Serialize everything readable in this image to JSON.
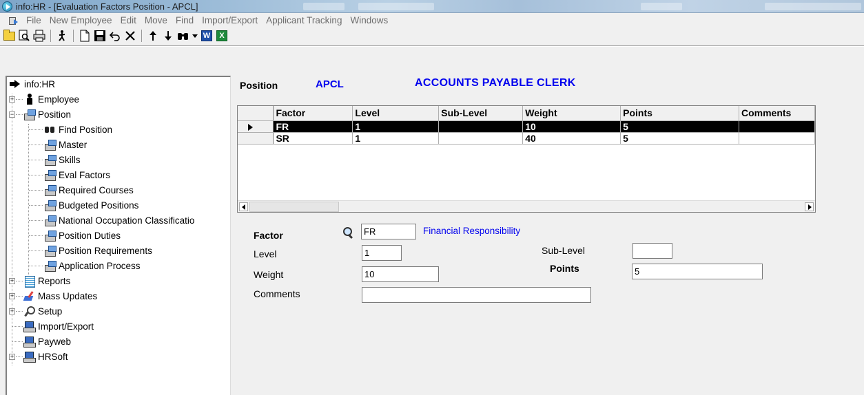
{
  "window": {
    "title": "info:HR - [Evaluation Factors Position - APCL]"
  },
  "menu": [
    "File",
    "New Employee",
    "Edit",
    "Move",
    "Find",
    "Import/Export",
    "Applicant Tracking",
    "Windows"
  ],
  "toolbar": {
    "icons": [
      "open-folder-icon",
      "print-preview-icon",
      "print-icon",
      "run-icon",
      "new-icon",
      "save-icon",
      "undo-icon",
      "delete-icon",
      "move-up-icon",
      "move-down-icon",
      "find-icon",
      "dropdown-icon",
      "word-icon",
      "excel-icon"
    ],
    "word_label": "W",
    "excel_label": "X"
  },
  "tree": {
    "root": "info:HR",
    "items": [
      {
        "label": "Employee"
      },
      {
        "label": "Position"
      },
      {
        "label": "Find Position"
      },
      {
        "label": "Master"
      },
      {
        "label": "Skills"
      },
      {
        "label": "Eval Factors"
      },
      {
        "label": "Required Courses"
      },
      {
        "label": "Budgeted Positions"
      },
      {
        "label": "National Occupation Classificatio"
      },
      {
        "label": "Position Duties"
      },
      {
        "label": "Position Requirements"
      },
      {
        "label": "Application Process"
      },
      {
        "label": "Reports"
      },
      {
        "label": "Mass Updates"
      },
      {
        "label": "Setup"
      },
      {
        "label": "Import/Export"
      },
      {
        "label": "Payweb"
      },
      {
        "label": "HRSoft"
      }
    ]
  },
  "position": {
    "label": "Position",
    "code": "APCL",
    "description": "ACCOUNTS PAYABLE CLERK"
  },
  "grid": {
    "columns": [
      "Factor",
      "Level",
      "Sub-Level",
      "Weight",
      "Points",
      "Comments"
    ],
    "rows": [
      [
        "FR",
        "1",
        "",
        "10",
        "5",
        ""
      ],
      [
        "SR",
        "1",
        "",
        "40",
        "5",
        ""
      ]
    ],
    "selected_row": 0
  },
  "form": {
    "factor_label": "Factor",
    "factor_value": "FR",
    "factor_description": "Financial Responsibility",
    "level_label": "Level",
    "level_value": "1",
    "sublevel_label": "Sub-Level",
    "sublevel_value": "",
    "weight_label": "Weight",
    "weight_value": "10",
    "points_label": "Points",
    "points_value": "5",
    "comments_label": "Comments",
    "comments_value": ""
  }
}
